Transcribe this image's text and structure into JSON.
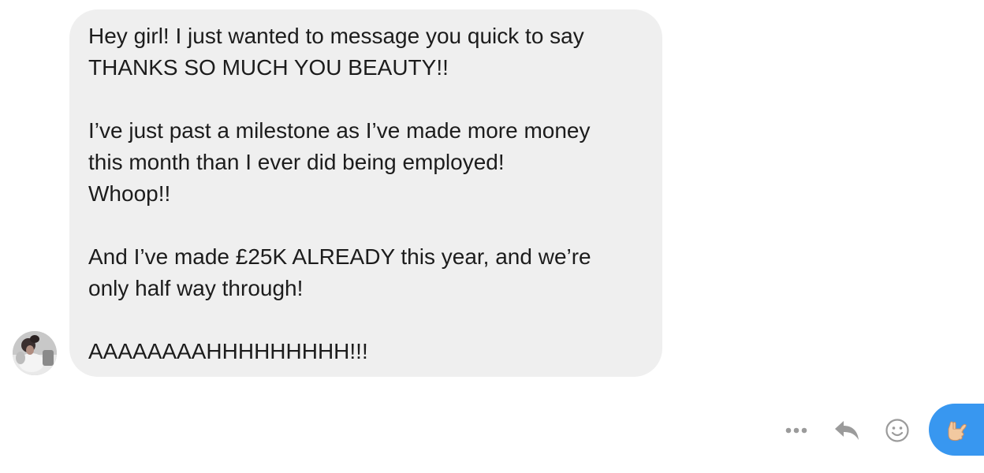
{
  "message": {
    "paragraphs": [
      "Hey girl! I just wanted to message you quick to say\nTHANKS SO MUCH YOU BEAUTY!!",
      "I’ve just past a milestone as I’ve made more money\nthis month than I ever did being employed!\nWhoop!!",
      "And I’ve made £25K ALREADY this year, and we’re\nonly half way through!",
      "AAAAAAAAHHHHHHHHH!!!"
    ]
  },
  "actions": {
    "more_icon": "more-horizontal-icon",
    "reply_icon": "reply-icon",
    "react_icon": "smiley-icon"
  },
  "sent_reaction": {
    "emoji_icon": "call-me-hand-icon"
  },
  "colors": {
    "bubble_background": "#efefef",
    "message_text": "#1c1c1c",
    "action_icon": "#9b9b9b",
    "sent_bubble": "#3897f0"
  }
}
